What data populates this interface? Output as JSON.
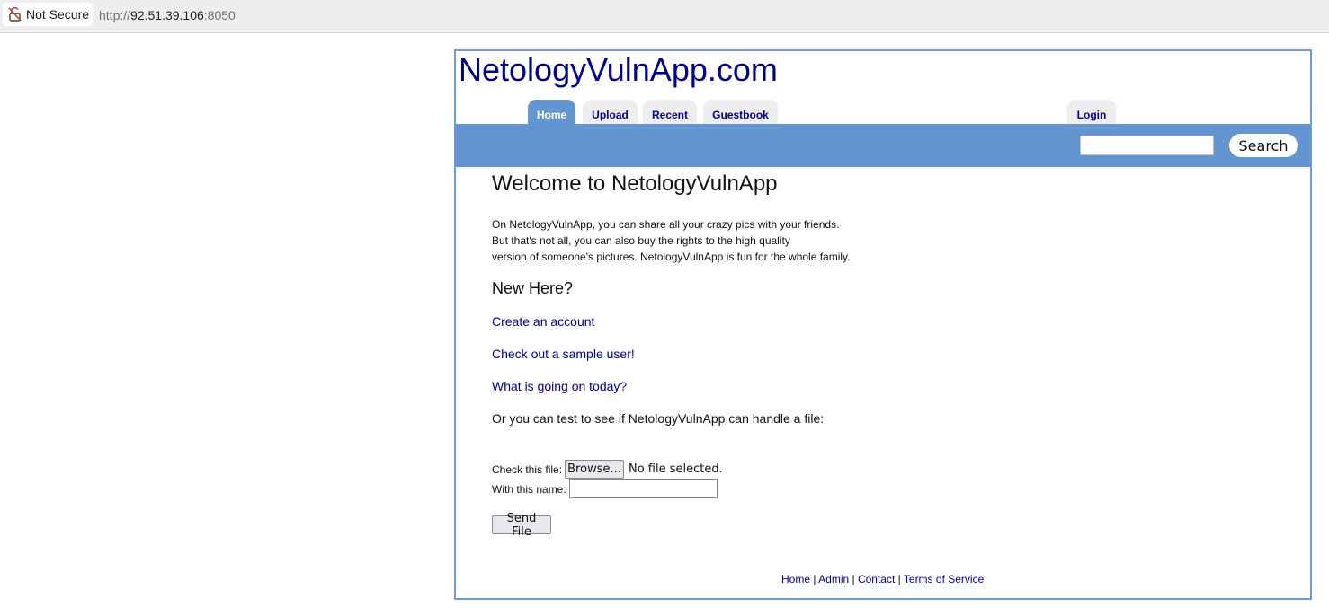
{
  "browser": {
    "security_label": "Not Secure",
    "url_protocol": "http://",
    "url_host": "92.51.39.106",
    "url_port": ":8050"
  },
  "site": {
    "logo": "NetologyVulnApp.com"
  },
  "tabs": [
    {
      "label": "Home",
      "active": true
    },
    {
      "label": "Upload",
      "active": false
    },
    {
      "label": "Recent",
      "active": false
    },
    {
      "label": "Guestbook",
      "active": false
    },
    {
      "label": "Login",
      "active": false
    }
  ],
  "search": {
    "value": "",
    "button_label": "Search"
  },
  "main": {
    "heading": "Welcome to NetologyVulnApp",
    "intro_lines": [
      "On NetologyVulnApp, you can share all your crazy pics with your friends.",
      "But that's not all, you can also buy the rights to the high quality",
      "version of someone's pictures. NetologyVulnApp is fun for the whole family."
    ],
    "new_here_heading": "New Here?",
    "links": [
      "Create an account",
      "Check out a sample user!",
      "What is going on today?"
    ],
    "test_text": "Or you can test to see if NetologyVulnApp can handle a file:"
  },
  "file_form": {
    "file_label": "Check this file:",
    "browse_label": "Browse...",
    "no_file_text": "No file selected.",
    "name_label": "With this name:",
    "name_value": "",
    "send_label": "Send File"
  },
  "footer": {
    "links": [
      "Home",
      "Admin",
      "Contact",
      "Terms of Service"
    ],
    "separator": " | "
  },
  "colors": {
    "nav_blue": "#6495d0",
    "link_blue": "#00008b",
    "frame_border": "#6b9bd0"
  }
}
